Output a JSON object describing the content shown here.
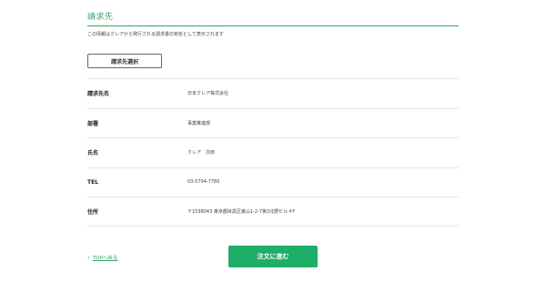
{
  "section": {
    "title": "請求先",
    "description": "この情報はクレアから発行される請求書の宛名として表示されます"
  },
  "select_button_label": "請求先選択",
  "rows": [
    {
      "label": "請求先名",
      "value": "日本クレア株式会社"
    },
    {
      "label": "部署",
      "value": "事業推進部"
    },
    {
      "label": "氏名",
      "value": "クレア　次郎"
    },
    {
      "label": "TEL",
      "value": "03-5794-7780"
    },
    {
      "label": "住所",
      "value": "〒1538043 東京都目黒区東山1-2-7第3北野ビル４F"
    }
  ],
  "back_link": {
    "icon": "chevron-left-icon",
    "label": "TOPへ戻る"
  },
  "next_button_label": "注文に進む",
  "colors": {
    "accent": "#2fa85f",
    "button": "#1fae67"
  }
}
